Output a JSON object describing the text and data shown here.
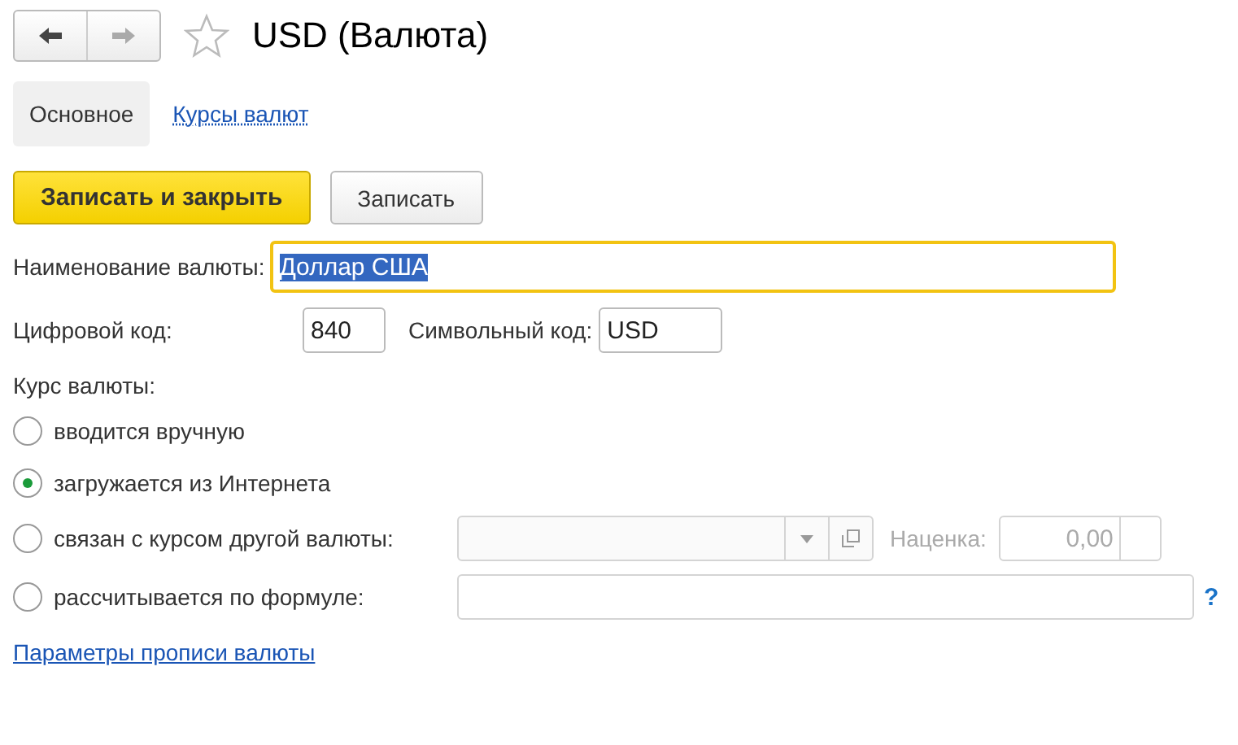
{
  "header": {
    "title": "USD (Валюта)"
  },
  "tabs": [
    {
      "label": "Основное",
      "selected": true
    },
    {
      "label": "Курсы валют",
      "selected": false
    }
  ],
  "buttons": [
    {
      "label": "Записать и закрыть",
      "kind": "primary"
    },
    {
      "label": "Записать",
      "kind": "default"
    }
  ],
  "name_field": {
    "label": "Наименование валюты:",
    "value": "Доллар США",
    "text_selected": true
  },
  "codes": [
    {
      "label": "Цифровой код:",
      "value": "840"
    },
    {
      "label": "Символьный код:",
      "value": "USD"
    }
  ],
  "rate": {
    "label": "Курс валюты:",
    "options": [
      {
        "label": "вводится вручную",
        "selected": false,
        "kind": "plain"
      },
      {
        "label": "загружается из Интернета",
        "selected": true,
        "kind": "plain"
      },
      {
        "label": "связан с курсом другой валюты:",
        "selected": false,
        "kind": "linked",
        "disabled": true,
        "markup_label": "Наценка:",
        "markup_value": "0,00"
      },
      {
        "label": "рассчитывается по формуле:",
        "selected": false,
        "kind": "formula",
        "help": "?"
      }
    ]
  },
  "footer_link": "Параметры прописи валюты"
}
